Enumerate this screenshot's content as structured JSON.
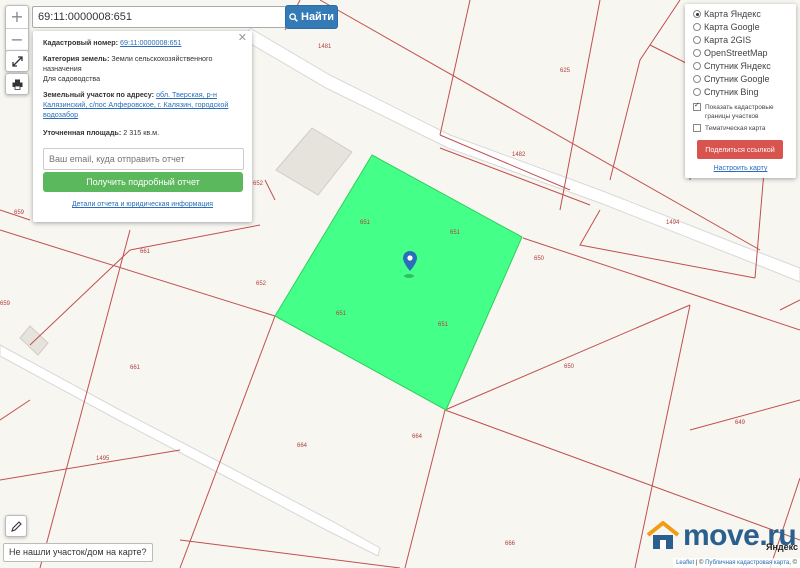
{
  "search": {
    "value": "69:11:0000008:651",
    "button_label": "Найти"
  },
  "zoom": {
    "in_label": "+",
    "out_label": "−"
  },
  "info_panel": {
    "close_label": "✕",
    "cadastral_label": "Кадастровый номер:",
    "cadastral_value": "69:11:0000008:651",
    "category_label": "Категория земель:",
    "category_value": "Земли сельскохозяйственного назначения",
    "use_value": "Для садоводства",
    "address_label": "Земельный участок по адресу:",
    "address_value": "обл. Тверская, р-н Калязинский, с/пос Алферовское, г. Калязин, городской водозабор",
    "area_label": "Уточненная площадь:",
    "area_value": "2 315 кв.м.",
    "email_placeholder": "Ваш email, куда отправить отчет",
    "report_button": "Получить подробный отчет",
    "details_link": "Детали отчета и юридическая информация"
  },
  "layers": {
    "options": [
      {
        "label": "Карта Яндекс",
        "selected": true
      },
      {
        "label": "Карта Google",
        "selected": false
      },
      {
        "label": "Карта 2GIS",
        "selected": false
      },
      {
        "label": "OpenStreetMap",
        "selected": false
      },
      {
        "label": "Спутник Яндекс",
        "selected": false
      },
      {
        "label": "Спутник Google",
        "selected": false
      },
      {
        "label": "Спутник Bing",
        "selected": false
      }
    ],
    "show_borders_label": "Показать кадастровые границы участков",
    "show_borders_checked": true,
    "thematic_label": "Тематическая карта",
    "thematic_checked": false,
    "share_button": "Поделиться ссылкой",
    "configure_link": "Настроить карту"
  },
  "map": {
    "highlight_color": "#44ff88",
    "parcel_line_color": "#c05050",
    "parcel_labels": [
      "1481",
      "625",
      "1482",
      "1494",
      "650",
      "651",
      "651",
      "651",
      "651",
      "652",
      "652",
      "659",
      "659",
      "661",
      "661",
      "664",
      "664",
      "650",
      "649",
      "1495",
      "666"
    ]
  },
  "not_found_button": "Не нашли участок/дом на карте?",
  "brand": {
    "name": "move.ru"
  },
  "yandex_mark": "Яндекс",
  "attribution": {
    "leaflet": "Leaflet",
    "separator": " | © ",
    "source": "Публичная кадастровая карта",
    "suffix": ", ©"
  }
}
